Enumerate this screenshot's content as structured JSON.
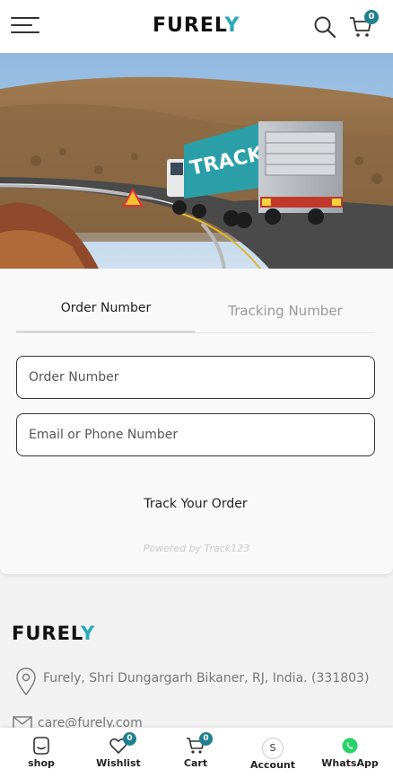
{
  "header": {
    "logo_main": "FUREL",
    "logo_accent": "Y",
    "icons": [
      "menu-icon",
      "search-icon",
      "cart-icon"
    ],
    "cart_count": "0"
  },
  "hero": {
    "truck_text": "TRACKING"
  },
  "tracker": {
    "tabs": [
      {
        "label": "Order Number",
        "active": true
      },
      {
        "label": "Tracking Number",
        "active": false
      }
    ],
    "order_placeholder": "Order Number",
    "email_placeholder": "Email or Phone Number",
    "track_button": "Track Your Order",
    "powered_by": "Powered by Track123"
  },
  "footer": {
    "logo_main": "FUREL",
    "logo_accent": "Y",
    "address": "Furely, Shri Dungargarh Bikaner, RJ, India. (331803)",
    "email": "care@furely.com"
  },
  "bottom_nav": {
    "items": [
      {
        "label": "shop",
        "icon": "shop-icon"
      },
      {
        "label": "Wishlist",
        "icon": "heart-icon",
        "badge": "0"
      },
      {
        "label": "Cart",
        "icon": "cart-icon",
        "badge": "0"
      },
      {
        "label": "Account",
        "icon": "account-icon",
        "initial": "S"
      },
      {
        "label": "WhatsApp",
        "icon": "whatsapp-icon"
      }
    ]
  },
  "colors": {
    "accent": "#1e7f8f",
    "logo_accent": "#2aa9b8",
    "whatsapp": "#25d366"
  }
}
